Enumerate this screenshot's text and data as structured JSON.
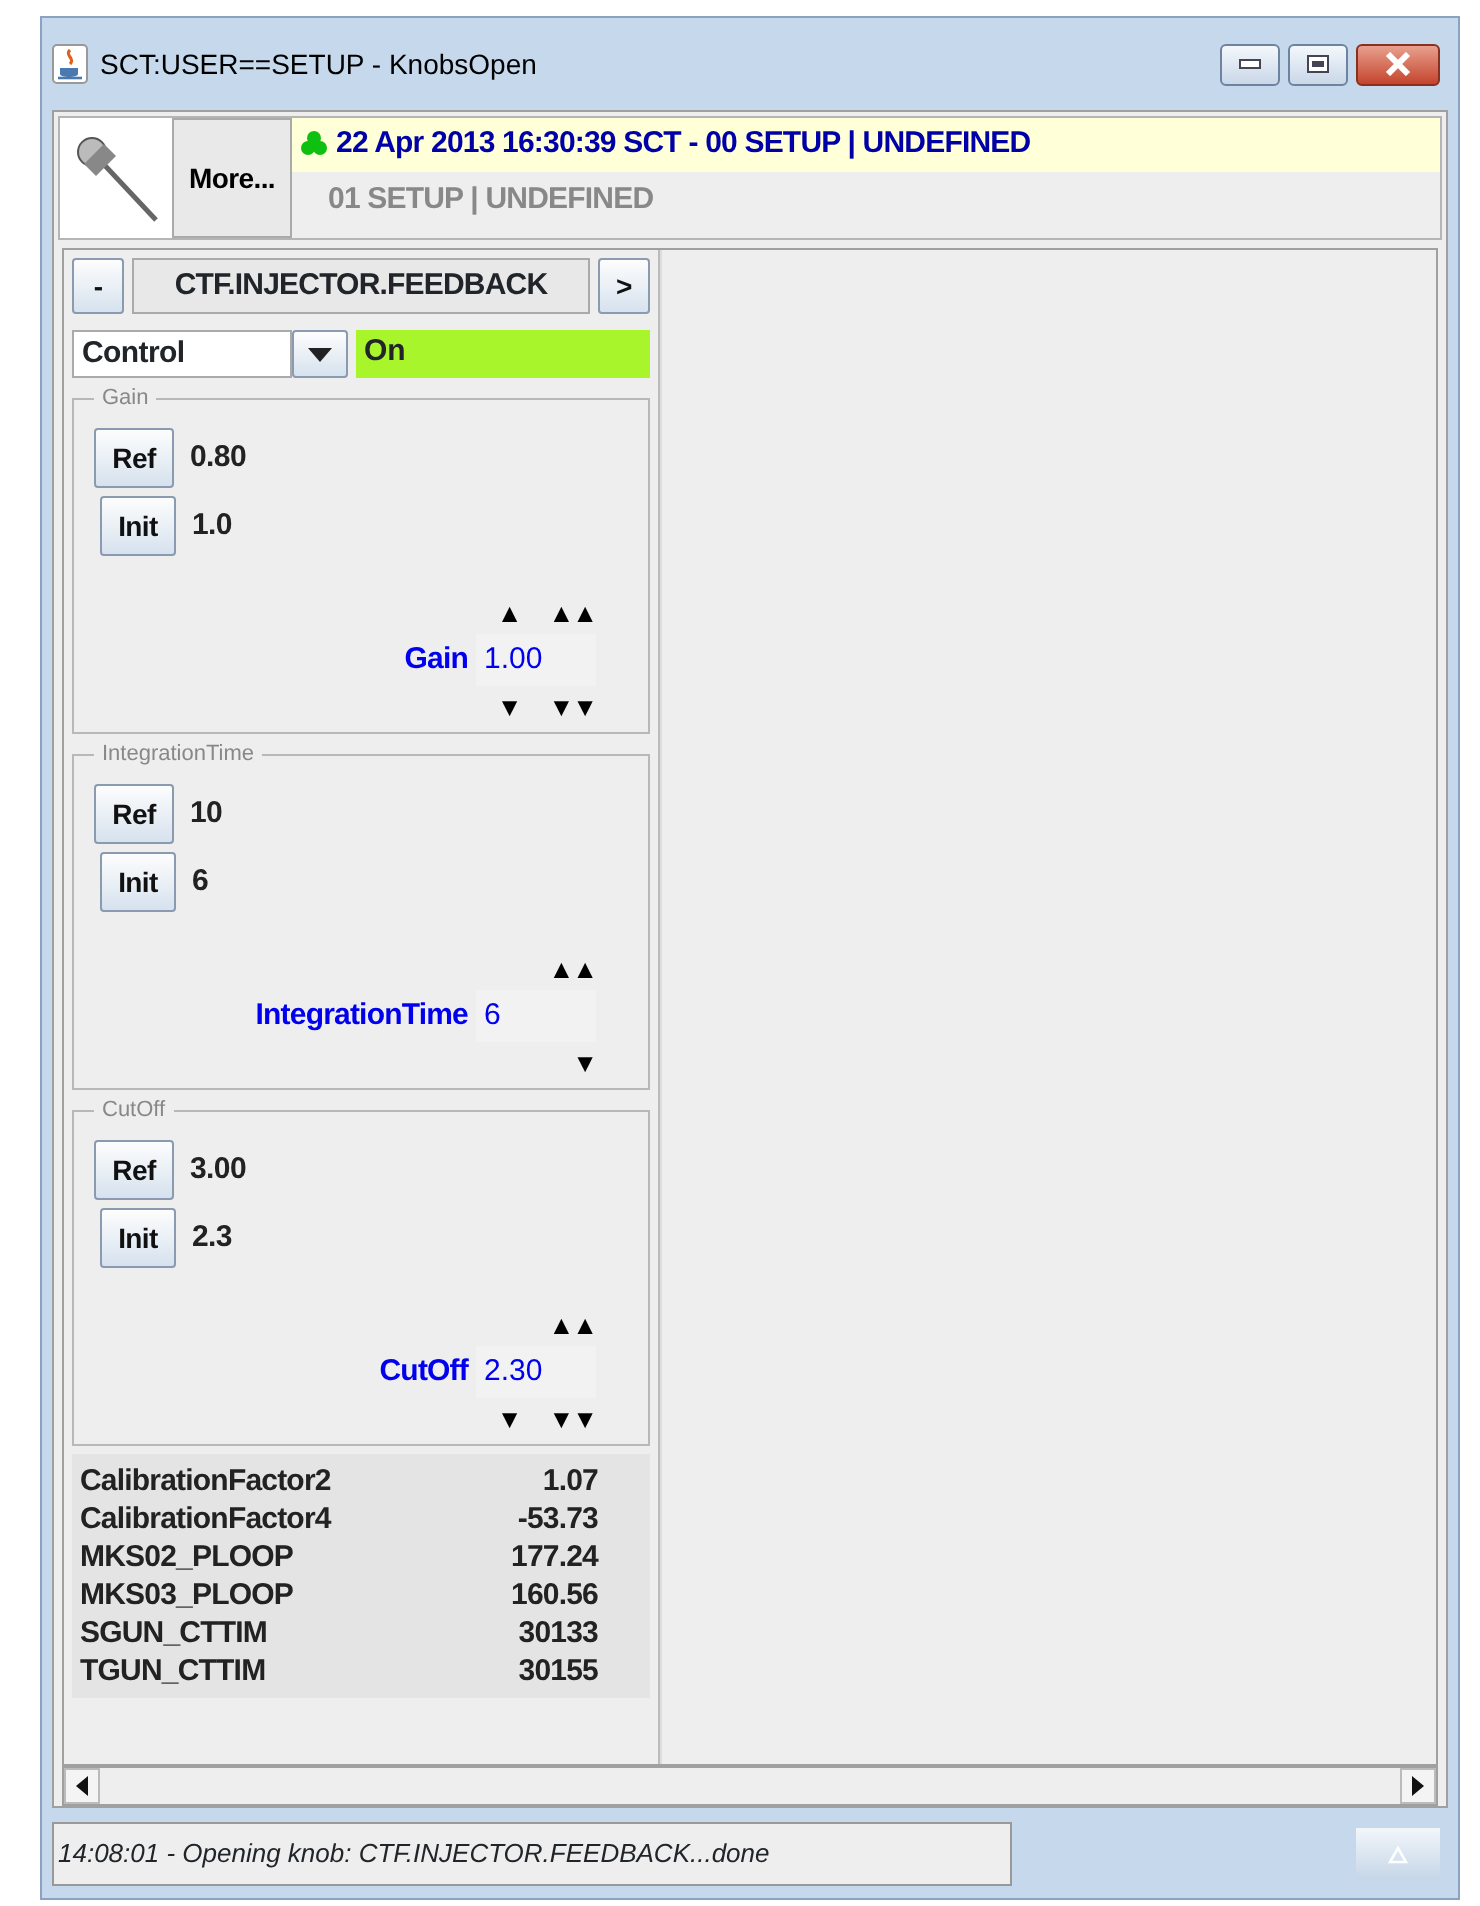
{
  "window": {
    "title": "SCT:USER==SETUP - KnobsOpen"
  },
  "header": {
    "more_button": "More...",
    "status_line": "22 Apr 2013  16:30:39  SCT - 00 SETUP | UNDEFINED",
    "sub_line": "01 SETUP | UNDEFINED"
  },
  "knob_panel": {
    "collapse_button": "-",
    "title": "CTF.INJECTOR.FEEDBACK",
    "next_button": ">",
    "mode": {
      "value": "Control",
      "state": "On",
      "active": true
    },
    "sections": [
      {
        "title": "Gain",
        "ref_button": "Ref",
        "ref_value": "0.80",
        "init_button": "Init",
        "init_value": "1.0",
        "label": "Gain",
        "value": "1.00",
        "up_arrows": [
          "▲",
          "▲▲"
        ],
        "down_arrows": [
          "▼",
          "▼▼"
        ]
      },
      {
        "title": "IntegrationTime",
        "ref_button": "Ref",
        "ref_value": "10",
        "init_button": "Init",
        "init_value": "6",
        "label": "IntegrationTime",
        "value": "6",
        "up_arrows": [
          "▲▲"
        ],
        "down_arrows": [
          "▼"
        ]
      },
      {
        "title": "CutOff",
        "ref_button": "Ref",
        "ref_value": "3.00",
        "init_button": "Init",
        "init_value": "2.3",
        "label": "CutOff",
        "value": "2.30",
        "up_arrows": [
          "▲▲"
        ],
        "down_arrows": [
          "▼",
          "▼▼"
        ]
      }
    ],
    "readings": [
      {
        "name": "CalibrationFactor2",
        "value": "1.07"
      },
      {
        "name": "CalibrationFactor4",
        "value": "-53.73"
      },
      {
        "name": "MKS02_PLOOP",
        "value": "177.24"
      },
      {
        "name": "MKS03_PLOOP",
        "value": "160.56"
      },
      {
        "name": "SGUN_CTTIM",
        "value": "30133"
      },
      {
        "name": "TGUN_CTTIM",
        "value": "30155"
      }
    ]
  },
  "status_bar": {
    "message": "14:08:01 - Opening knob: CTF.INJECTOR.FEEDBACK...done"
  }
}
